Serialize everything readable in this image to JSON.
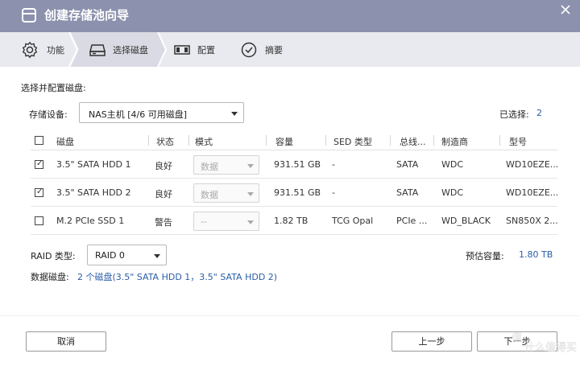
{
  "window": {
    "title": "创建存储池向导"
  },
  "wizard": {
    "steps": [
      {
        "label": "功能",
        "icon": "gear-icon"
      },
      {
        "label": "选择磁盘",
        "icon": "drive-icon",
        "active": true
      },
      {
        "label": "配置",
        "icon": "raid-config-icon"
      },
      {
        "label": "摘要",
        "icon": "check-circle-icon"
      }
    ]
  },
  "main": {
    "section_title": "选择并配置磁盘:",
    "storage_device_label": "存储设备:",
    "storage_device_value": "NAS主机 [4/6 可用磁盘]",
    "selected_label": "已选择:",
    "selected_count": "2"
  },
  "table": {
    "headers": [
      "磁盘",
      "状态",
      "模式",
      "容量",
      "SED 类型",
      "总线...",
      "制造商",
      "型号"
    ],
    "rows": [
      {
        "checked": true,
        "disk": "3.5\" SATA HDD 1",
        "status": "良好",
        "mode": "数据",
        "capacity": "931.51 GB",
        "sed": "-",
        "bus": "SATA",
        "vendor": "WDC",
        "model": "WD10EZE..."
      },
      {
        "checked": true,
        "disk": "3.5\" SATA HDD 2",
        "status": "良好",
        "mode": "数据",
        "capacity": "931.51 GB",
        "sed": "-",
        "bus": "SATA",
        "vendor": "WDC",
        "model": "WD10EZE..."
      },
      {
        "checked": false,
        "disk": "M.2 PCIe SSD 1",
        "status": "警告",
        "mode": "--",
        "capacity": "1.82 TB",
        "sed": "TCG Opal",
        "bus": "PCIe ...",
        "vendor": "WD_BLACK",
        "model": "SN850X 2..."
      }
    ]
  },
  "raid": {
    "label": "RAID 类型:",
    "value": "RAID 0",
    "capacity_label": "预估容量:",
    "capacity_value": "1.80 TB",
    "data_disk_label": "数据磁盘:",
    "data_disk_value": "2 个磁盘(3.5\" SATA HDD 1，3.5\" SATA HDD 2)"
  },
  "buttons": {
    "cancel": "取消",
    "back": "上一步",
    "next": "下一步"
  },
  "watermark": {
    "text": "值 什么值得买"
  },
  "colors": {
    "titlebar": "#8c91ad",
    "wizard_bg": "#e9eaef",
    "wizard_active": "#d9dae3",
    "link_blue": "#2a5ea8"
  }
}
